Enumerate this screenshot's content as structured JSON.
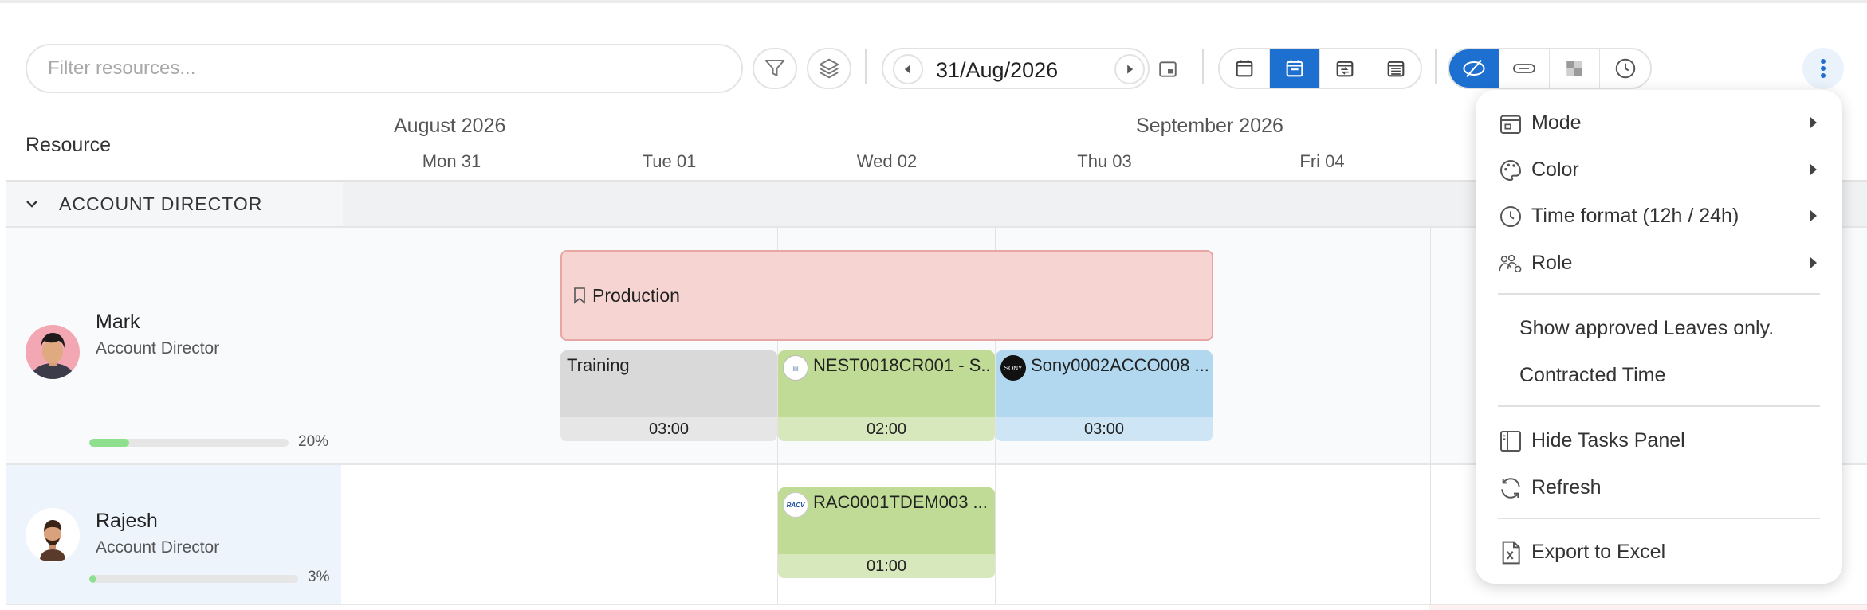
{
  "toolbar": {
    "filter_placeholder": "Filter resources...",
    "current_date": "31/Aug/2026"
  },
  "header": {
    "resource_label": "Resource",
    "months": [
      "August 2026",
      "September 2026"
    ],
    "days": [
      "Mon 31",
      "Tue 01",
      "Wed 02",
      "Thu 03",
      "Fri 04"
    ]
  },
  "group": {
    "label": "ACCOUNT DIRECTOR"
  },
  "resources": [
    {
      "name": "Mark",
      "role": "Account Director",
      "utilization": 0.2,
      "utilization_label": "20%"
    },
    {
      "name": "Rajesh",
      "role": "Account Director",
      "utilization": 0.03,
      "utilization_label": "3%"
    }
  ],
  "events": {
    "production": "Production",
    "training": {
      "title": "Training",
      "time": "03:00"
    },
    "nest": {
      "title": "NEST0018CR001 - S...",
      "time": "02:00"
    },
    "sony": {
      "title": "Sony0002ACCO008 ...",
      "time": "03:00",
      "logo": "SONY"
    },
    "racv": {
      "title": "RAC0001TDEM003 ...",
      "time": "01:00",
      "logo": "RACV"
    }
  },
  "menu": {
    "items": [
      {
        "label": "Mode",
        "icon": "calendar-mode-icon",
        "submenu": true
      },
      {
        "label": "Color",
        "icon": "palette-icon",
        "submenu": true
      },
      {
        "label": "Time format (12h / 24h)",
        "icon": "clock-icon",
        "submenu": true
      },
      {
        "label": "Role",
        "icon": "role-icon",
        "submenu": true
      },
      {
        "label": "Show approved Leaves only."
      },
      {
        "label": "Contracted Time"
      },
      {
        "label": "Hide Tasks Panel",
        "icon": "panel-icon"
      },
      {
        "label": "Refresh",
        "icon": "refresh-icon"
      },
      {
        "label": "Export to Excel",
        "icon": "excel-icon"
      }
    ]
  },
  "colors": {
    "accent": "#1d6fd0",
    "production_bg": "#f6d4d2",
    "training_bg": "#d9d9d9",
    "project_green": "#bfdb95",
    "project_blue": "#b2d8f0",
    "utilization_fill": "#8ee08e"
  }
}
